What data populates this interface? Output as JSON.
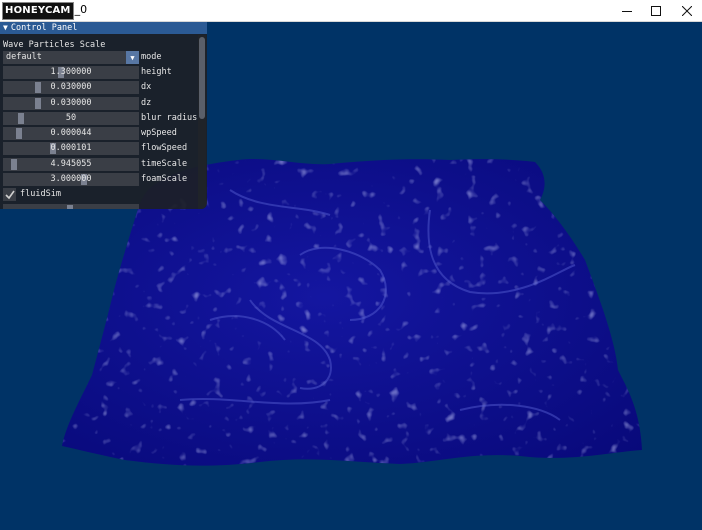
{
  "window": {
    "title_logo": "HONEYCAM",
    "title_suffix": "_0",
    "minimize_icon": "minimize-icon",
    "maximize_icon": "maximize-icon",
    "close_icon": "close-icon"
  },
  "panel": {
    "header": "Control Panel",
    "section_title": "Wave Particles Scale",
    "mode": {
      "value": "default",
      "label": "mode"
    },
    "sliders": [
      {
        "label": "height",
        "value": "1.300000",
        "fraction": 0.42
      },
      {
        "label": "dx",
        "value": "0.030000",
        "fraction": 0.24
      },
      {
        "label": "dz",
        "value": "0.030000",
        "fraction": 0.24
      },
      {
        "label": "blur radius",
        "value": "50",
        "fraction": 0.1
      },
      {
        "label": "wpSpeed",
        "value": "0.000044",
        "fraction": 0.09
      },
      {
        "label": "flowSpeed",
        "value": "0.000101",
        "fraction": 0.36
      },
      {
        "label": "timeScale",
        "value": "4.945055",
        "fraction": 0.05
      },
      {
        "label": "foamScale",
        "value": "3.000000",
        "fraction": 0.6
      }
    ],
    "checkbox": {
      "label": "fluidSim",
      "checked": true
    }
  },
  "colors": {
    "background": "#003366",
    "water": "#0a0e8a",
    "panel_header": "#2b5a94"
  }
}
